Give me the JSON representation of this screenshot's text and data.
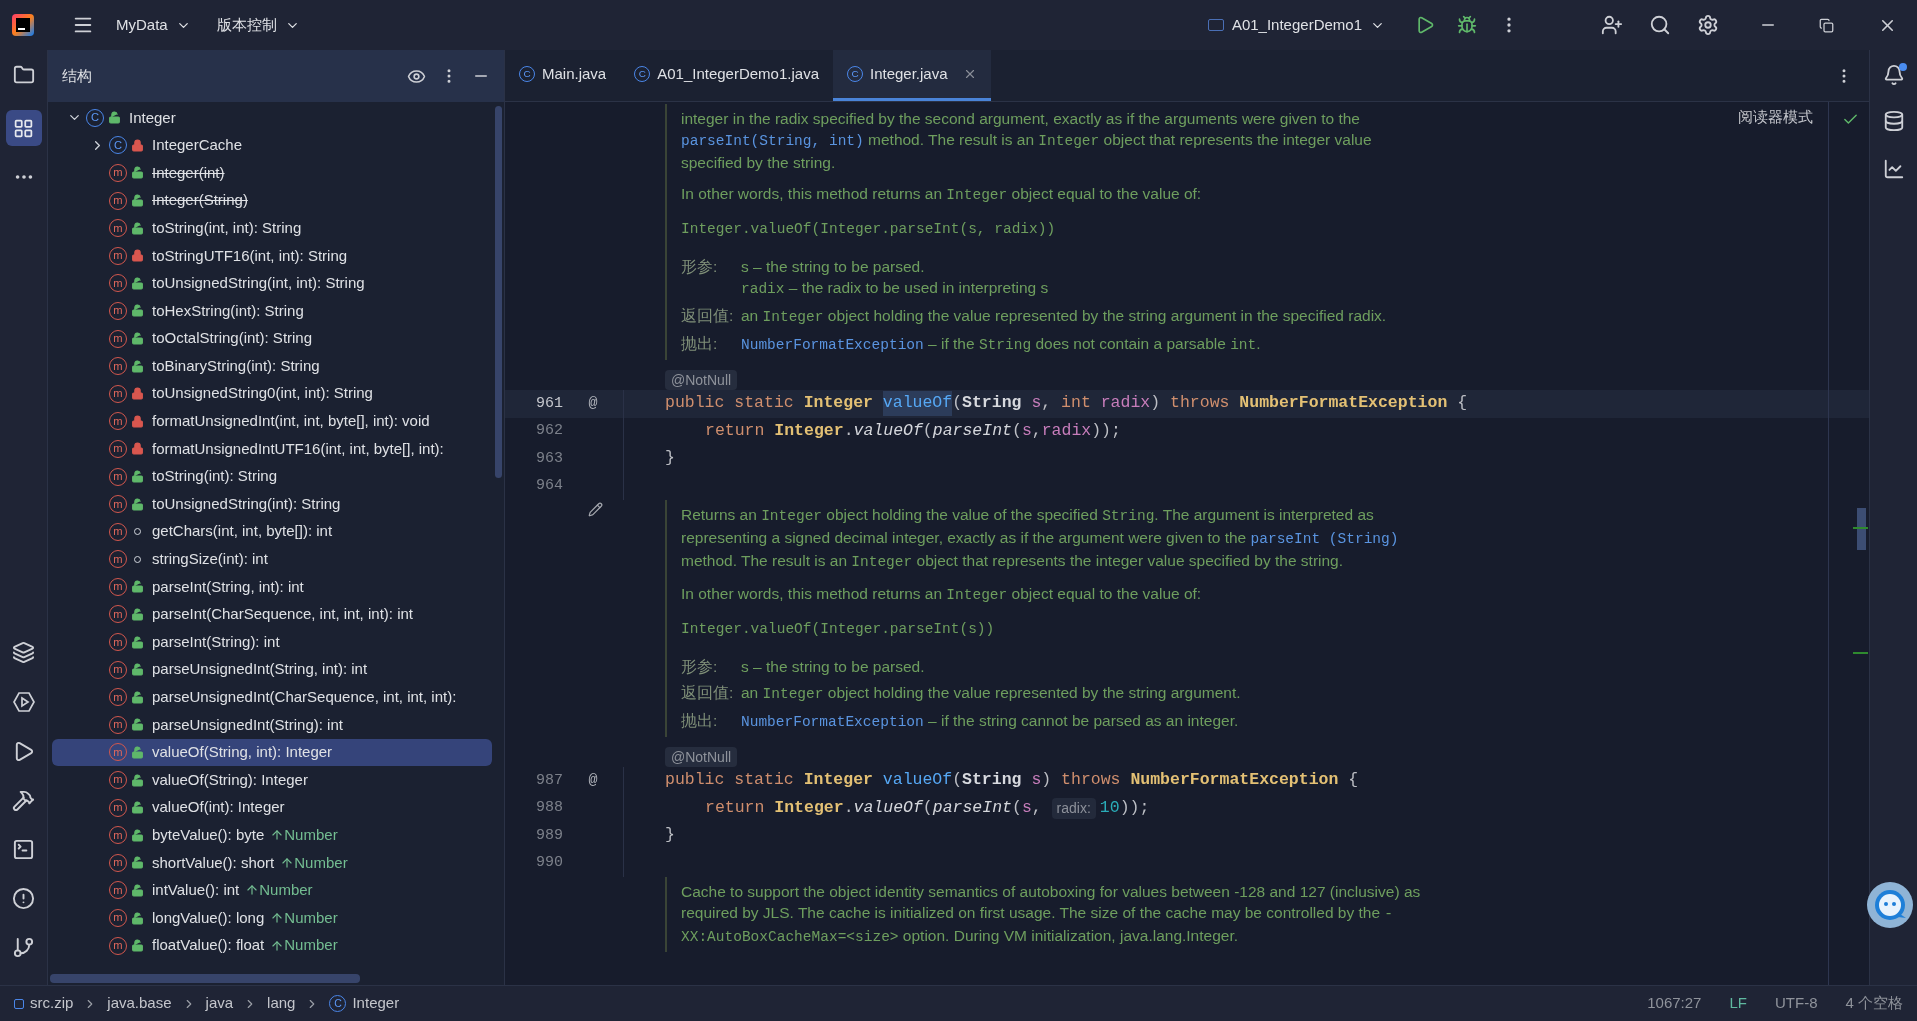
{
  "title_bar": {
    "project": "MyData",
    "vcs": "版本控制",
    "run_config": "A01_IntegerDemo1"
  },
  "structure_panel": {
    "title": "结构",
    "tree": {
      "label": "Integer",
      "icon_letter": "C",
      "kind": "class",
      "private": false,
      "package_private": false,
      "expanded": true,
      "selected": false,
      "children": [
        {
          "label": "IntegerCache",
          "icon_letter": "C",
          "kind": "class",
          "private": true,
          "package_private": false,
          "expanded": false,
          "selected": false
        },
        {
          "label": "Integer(int)",
          "icon_letter": "m",
          "kind": "method",
          "private": false,
          "package_private": false,
          "deprecated": true,
          "selected": false
        },
        {
          "label": "Integer(String)",
          "icon_letter": "m",
          "kind": "method",
          "private": false,
          "package_private": false,
          "deprecated": true,
          "selected": false
        },
        {
          "label": "toString(int, int): String",
          "icon_letter": "m",
          "kind": "method",
          "private": false,
          "package_private": false,
          "selected": false
        },
        {
          "label": "toStringUTF16(int, int): String",
          "icon_letter": "m",
          "kind": "method",
          "private": true,
          "package_private": false,
          "selected": false
        },
        {
          "label": "toUnsignedString(int, int): String",
          "icon_letter": "m",
          "kind": "method",
          "private": false,
          "package_private": false,
          "selected": false
        },
        {
          "label": "toHexString(int): String",
          "icon_letter": "m",
          "kind": "method",
          "private": false,
          "package_private": false,
          "selected": false
        },
        {
          "label": "toOctalString(int): String",
          "icon_letter": "m",
          "kind": "method",
          "private": false,
          "package_private": false,
          "selected": false
        },
        {
          "label": "toBinaryString(int): String",
          "icon_letter": "m",
          "kind": "method",
          "private": false,
          "package_private": false,
          "selected": false
        },
        {
          "label": "toUnsignedString0(int, int): String",
          "icon_letter": "m",
          "kind": "method",
          "private": true,
          "package_private": false,
          "selected": false
        },
        {
          "label": "formatUnsignedInt(int, int, byte[], int): void",
          "icon_letter": "m",
          "kind": "method",
          "private": true,
          "package_private": false,
          "selected": false
        },
        {
          "label": "formatUnsignedIntUTF16(int, int, byte[], int):",
          "icon_letter": "m",
          "kind": "method",
          "private": true,
          "package_private": false,
          "selected": false
        },
        {
          "label": "toString(int): String",
          "icon_letter": "m",
          "kind": "method",
          "private": false,
          "package_private": false,
          "selected": false
        },
        {
          "label": "toUnsignedString(int): String",
          "icon_letter": "m",
          "kind": "method",
          "private": false,
          "package_private": false,
          "selected": false
        },
        {
          "label": "getChars(int, int, byte[]): int",
          "icon_letter": "m",
          "kind": "method",
          "private": false,
          "package_private": true,
          "selected": false
        },
        {
          "label": "stringSize(int): int",
          "icon_letter": "m",
          "kind": "method",
          "private": false,
          "package_private": true,
          "selected": false
        },
        {
          "label": "parseInt(String, int): int",
          "icon_letter": "m",
          "kind": "method",
          "private": false,
          "package_private": false,
          "selected": false
        },
        {
          "label": "parseInt(CharSequence, int, int, int): int",
          "icon_letter": "m",
          "kind": "method",
          "private": false,
          "package_private": false,
          "selected": false
        },
        {
          "label": "parseInt(String): int",
          "icon_letter": "m",
          "kind": "method",
          "private": false,
          "package_private": false,
          "selected": false
        },
        {
          "label": "parseUnsignedInt(String, int): int",
          "icon_letter": "m",
          "kind": "method",
          "private": false,
          "package_private": false,
          "selected": false
        },
        {
          "label": "parseUnsignedInt(CharSequence, int, int, int):",
          "icon_letter": "m",
          "kind": "method",
          "private": false,
          "package_private": false,
          "selected": false
        },
        {
          "label": "parseUnsignedInt(String): int",
          "icon_letter": "m",
          "kind": "method",
          "private": false,
          "package_private": false,
          "selected": false
        },
        {
          "label": "valueOf(String, int): Integer",
          "icon_letter": "m",
          "kind": "method",
          "private": false,
          "package_private": false,
          "selected": true
        },
        {
          "label": "valueOf(String): Integer",
          "icon_letter": "m",
          "kind": "method",
          "private": false,
          "package_private": false,
          "selected": false
        },
        {
          "label": "valueOf(int): Integer",
          "icon_letter": "m",
          "kind": "method",
          "private": false,
          "package_private": false,
          "selected": false
        },
        {
          "label": "byteValue(): byte",
          "icon_letter": "m",
          "kind": "method",
          "private": false,
          "package_private": false,
          "inherited_from": "Number",
          "selected": false
        },
        {
          "label": "shortValue(): short",
          "icon_letter": "m",
          "kind": "method",
          "private": false,
          "package_private": false,
          "inherited_from": "Number",
          "selected": false
        },
        {
          "label": "intValue(): int",
          "icon_letter": "m",
          "kind": "method",
          "private": false,
          "package_private": false,
          "inherited_from": "Number",
          "selected": false
        },
        {
          "label": "longValue(): long",
          "icon_letter": "m",
          "kind": "method",
          "private": false,
          "package_private": false,
          "inherited_from": "Number",
          "selected": false
        },
        {
          "label": "floatValue(): float",
          "icon_letter": "m",
          "kind": "method",
          "private": false,
          "package_private": false,
          "inherited_from": "Number",
          "selected": false
        }
      ]
    }
  },
  "tabs": [
    {
      "label": "Main.java",
      "icon_letter": "C",
      "selected": false
    },
    {
      "label": "A01_IntegerDemo1.java",
      "icon_letter": "C",
      "selected": false
    },
    {
      "label": "Integer.java",
      "icon_letter": "C",
      "selected": true
    }
  ],
  "editor": {
    "reader_mode": "阅读器模式",
    "blocks": [
      {
        "kind": "doc",
        "edit_toggle": false,
        "paragraphs": [
          [
            {
              "text": "integer in the radix specified by the second argument, exactly as if the arguments were given to the ",
              "kind": "text"
            },
            {
              "text": "parseInt(String, int)",
              "kind": "link"
            },
            {
              "text": " method. The result is an ",
              "kind": "text"
            },
            {
              "text": "Integer",
              "kind": "code"
            },
            {
              "text": " object that represents the integer value specified by the string.",
              "kind": "text"
            }
          ],
          [
            {
              "text": "In other words, this method returns an ",
              "kind": "text"
            },
            {
              "text": "Integer",
              "kind": "code"
            },
            {
              "text": " object equal to the value of:",
              "kind": "text"
            }
          ]
        ],
        "example": "Integer.valueOf(Integer.parseInt(s, radix))",
        "tags": [
          {
            "label": "形参:",
            "lines": [
              [
                {
                  "text": "s – the string to be parsed.",
                  "kind": "text"
                }
              ],
              [
                {
                  "text": "radix",
                  "kind": "code"
                },
                {
                  "text": " – the radix to be used in interpreting s",
                  "kind": "text"
                }
              ]
            ]
          },
          {
            "label": "返回值:",
            "lines": [
              [
                {
                  "text": "an ",
                  "kind": "text"
                },
                {
                  "text": "Integer",
                  "kind": "code"
                },
                {
                  "text": " object holding the value represented by the string argument in the specified radix.",
                  "kind": "text"
                }
              ]
            ]
          },
          {
            "label": "抛出:",
            "lines": [
              [
                {
                  "text": "NumberFormatException",
                  "kind": "link"
                },
                {
                  "text": " – if the ",
                  "kind": "text"
                },
                {
                  "text": "String",
                  "kind": "code"
                },
                {
                  "text": " does not contain a parsable ",
                  "kind": "text"
                },
                {
                  "text": "int",
                  "kind": "code"
                },
                {
                  "text": ".",
                  "kind": "text"
                }
              ]
            ]
          }
        ]
      },
      {
        "kind": "annotation",
        "text": "@NotNull"
      },
      {
        "kind": "code",
        "number": "961",
        "gutter": "@",
        "current": true,
        "indented": false,
        "tokens": [
          {
            "text": "public ",
            "kind": "keyword"
          },
          {
            "text": "static ",
            "kind": "keyword"
          },
          {
            "text": "Integer ",
            "kind": "type"
          },
          {
            "text": "valueOf",
            "kind": "decl",
            "highlighted": true
          },
          {
            "text": "(",
            "kind": "plain"
          },
          {
            "text": "String ",
            "kind": "type2"
          },
          {
            "text": "s",
            "kind": "param"
          },
          {
            "text": ", ",
            "kind": "plain"
          },
          {
            "text": "int ",
            "kind": "keyword"
          },
          {
            "text": "radix",
            "kind": "param"
          },
          {
            "text": ") ",
            "kind": "plain"
          },
          {
            "text": "throws ",
            "kind": "keyword"
          },
          {
            "text": "NumberFormatException ",
            "kind": "type"
          },
          {
            "text": "{",
            "kind": "plain"
          }
        ]
      },
      {
        "kind": "code",
        "number": "962",
        "current": false,
        "indented": true,
        "tokens": [
          {
            "text": "return ",
            "kind": "keyword"
          },
          {
            "text": "Integer",
            "kind": "type"
          },
          {
            "text": ".",
            "kind": "plain"
          },
          {
            "text": "valueOf",
            "kind": "call"
          },
          {
            "text": "(",
            "kind": "plain"
          },
          {
            "text": "parseInt",
            "kind": "call"
          },
          {
            "text": "(",
            "kind": "plain"
          },
          {
            "text": "s",
            "kind": "param"
          },
          {
            "text": ",",
            "kind": "plain"
          },
          {
            "text": "radix",
            "kind": "param"
          },
          {
            "text": "));",
            "kind": "plain"
          }
        ]
      },
      {
        "kind": "code",
        "number": "963",
        "current": false,
        "indented": false,
        "tokens": [
          {
            "text": "}",
            "kind": "plain"
          }
        ]
      },
      {
        "kind": "code",
        "number": "964",
        "current": false
      },
      {
        "kind": "doc",
        "edit_toggle": true,
        "paragraphs": [
          [
            {
              "text": "Returns an ",
              "kind": "text"
            },
            {
              "text": "Integer",
              "kind": "code"
            },
            {
              "text": " object holding the value of the specified ",
              "kind": "text"
            },
            {
              "text": "String",
              "kind": "code"
            },
            {
              "text": ". The argument is interpreted as representing a signed decimal integer, exactly as if the argument were given to the ",
              "kind": "text"
            },
            {
              "text": "parseInt (String)",
              "kind": "link"
            },
            {
              "text": " method. The result is an ",
              "kind": "text"
            },
            {
              "text": "Integer",
              "kind": "code"
            },
            {
              "text": " object that represents the integer value specified by the string.",
              "kind": "text"
            }
          ],
          [
            {
              "text": "In other words, this method returns an ",
              "kind": "text"
            },
            {
              "text": "Integer",
              "kind": "code"
            },
            {
              "text": " object equal to the value of:",
              "kind": "text"
            }
          ]
        ],
        "example": "Integer.valueOf(Integer.parseInt(s))",
        "tags": [
          {
            "label": "形参:",
            "lines": [
              [
                {
                  "text": "s – the string to be parsed.",
                  "kind": "text"
                }
              ]
            ]
          },
          {
            "label": "返回值:",
            "lines": [
              [
                {
                  "text": "an ",
                  "kind": "text"
                },
                {
                  "text": "Integer",
                  "kind": "code"
                },
                {
                  "text": " object holding the value represented by the string argument.",
                  "kind": "text"
                }
              ]
            ]
          },
          {
            "label": "抛出:",
            "lines": [
              [
                {
                  "text": "NumberFormatException",
                  "kind": "link"
                },
                {
                  "text": " – if the string cannot be parsed as an integer.",
                  "kind": "text"
                }
              ]
            ]
          }
        ]
      },
      {
        "kind": "annotation",
        "text": "@NotNull"
      },
      {
        "kind": "code",
        "number": "987",
        "gutter": "@",
        "current": false,
        "indented": false,
        "tokens": [
          {
            "text": "public ",
            "kind": "keyword"
          },
          {
            "text": "static ",
            "kind": "keyword"
          },
          {
            "text": "Integer ",
            "kind": "type"
          },
          {
            "text": "valueOf",
            "kind": "decl",
            "highlighted": false
          },
          {
            "text": "(",
            "kind": "plain"
          },
          {
            "text": "String ",
            "kind": "type2"
          },
          {
            "text": "s",
            "kind": "param"
          },
          {
            "text": ") ",
            "kind": "plain"
          },
          {
            "text": "throws ",
            "kind": "keyword"
          },
          {
            "text": "NumberFormatException ",
            "kind": "type"
          },
          {
            "text": "{",
            "kind": "plain"
          }
        ]
      },
      {
        "kind": "code",
        "number": "988",
        "current": false,
        "indented": true,
        "tokens": [
          {
            "text": "return ",
            "kind": "keyword"
          },
          {
            "text": "Integer",
            "kind": "type"
          },
          {
            "text": ".",
            "kind": "plain"
          },
          {
            "text": "valueOf",
            "kind": "call"
          },
          {
            "text": "(",
            "kind": "plain"
          },
          {
            "text": "parseInt",
            "kind": "call"
          },
          {
            "text": "(",
            "kind": "plain"
          },
          {
            "text": "s",
            "kind": "param"
          },
          {
            "text": ", ",
            "kind": "plain"
          },
          {
            "text": "radix:",
            "kind": "hint"
          },
          {
            "text": "10",
            "kind": "number"
          },
          {
            "text": "));",
            "kind": "plain"
          }
        ]
      },
      {
        "kind": "code",
        "number": "989",
        "current": false,
        "indented": false,
        "tokens": [
          {
            "text": "}",
            "kind": "plain"
          }
        ]
      },
      {
        "kind": "code",
        "number": "990",
        "current": false
      },
      {
        "kind": "doc",
        "edit_toggle": false,
        "paragraphs": [
          [
            {
              "text": "Cache to support the object identity semantics of autoboxing for values between -128 and 127 (inclusive) as required by JLS. The cache is initialized on first usage. The size of the cache may be controlled by the ",
              "kind": "text"
            },
            {
              "text": "-XX:AutoBoxCacheMax=<size>",
              "kind": "code"
            },
            {
              "text": " option. During VM initialization, java.lang.Integer.",
              "kind": "text"
            }
          ]
        ]
      }
    ]
  },
  "breadcrumbs": [
    {
      "label": "src.zip"
    },
    {
      "label": "java.base"
    },
    {
      "label": "java"
    },
    {
      "label": "lang"
    },
    {
      "label": "Integer",
      "icon_letter": "C"
    }
  ],
  "status_bar": [
    "1067:27",
    "LF",
    "UTF-8",
    "4 个空格"
  ]
}
